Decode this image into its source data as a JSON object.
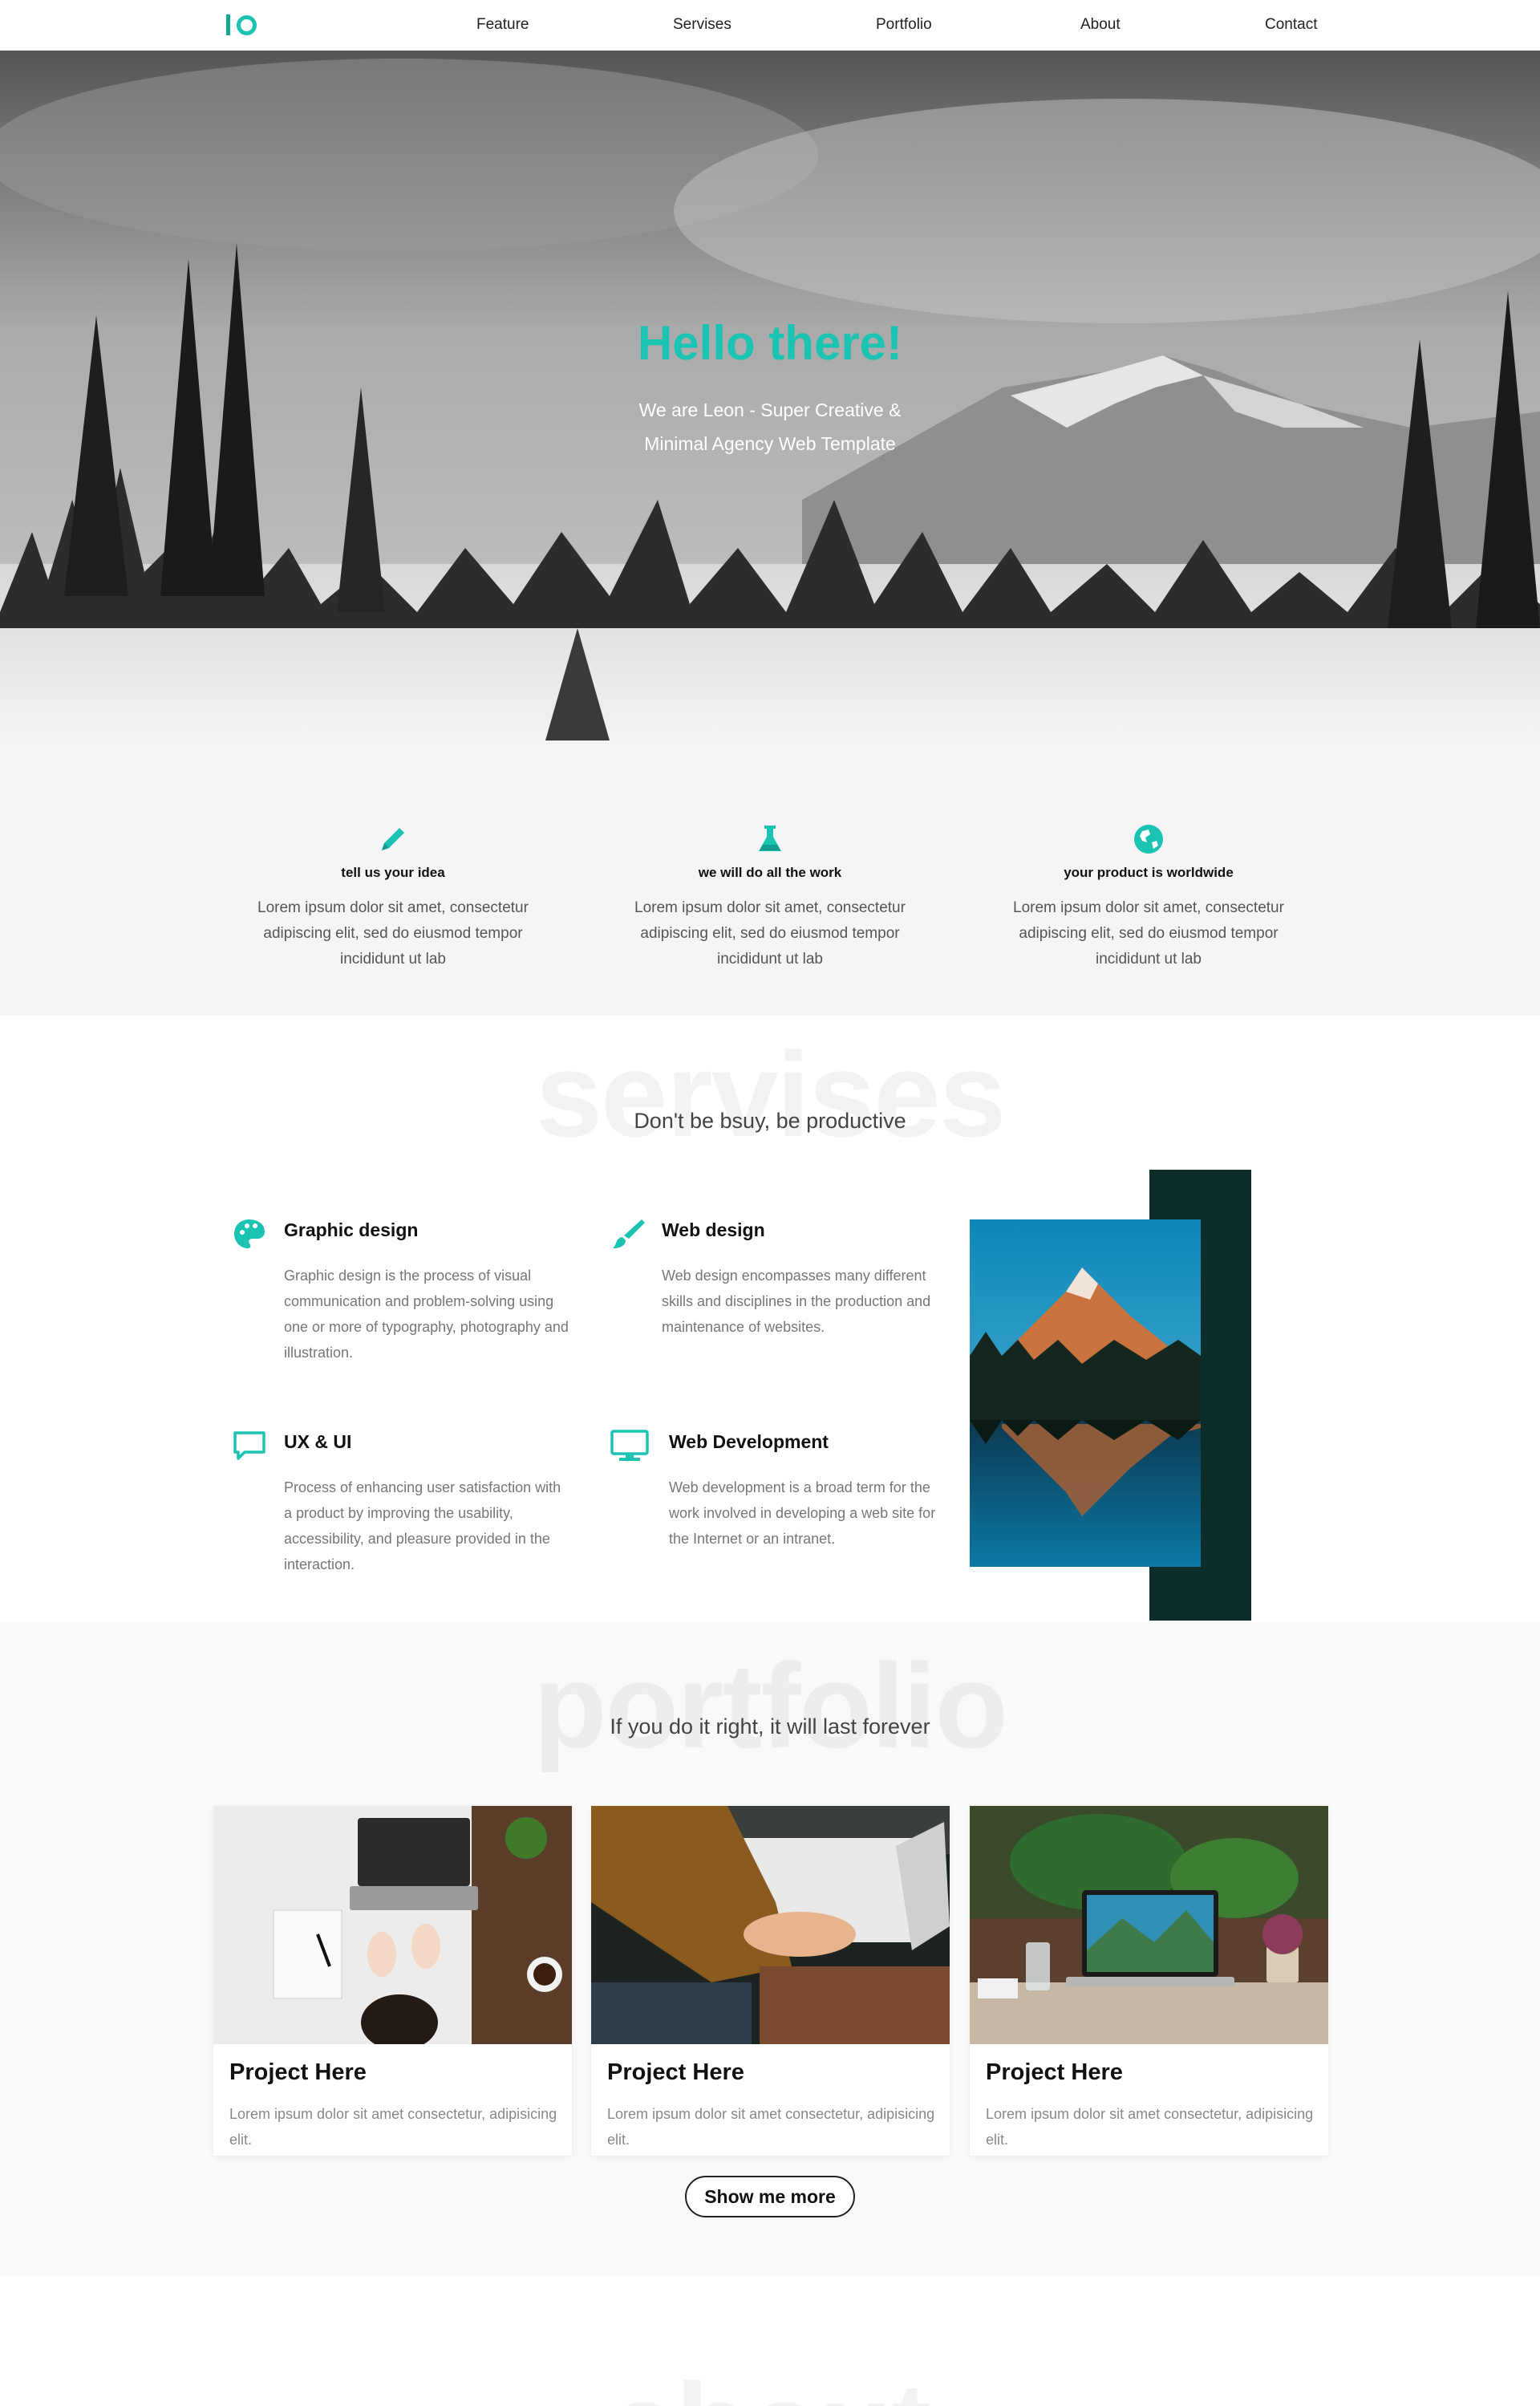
{
  "nav": {
    "items": [
      "Feature",
      "Servises",
      "Portfolio",
      "About",
      "Contact"
    ]
  },
  "hero": {
    "title": "Hello there!",
    "subtitle": "We are Leon - Super Creative & Minimal Agency Web Template"
  },
  "features": [
    {
      "icon": "pencil-icon",
      "title": "tell us your idea",
      "text": "Lorem ipsum dolor sit amet, consectetur adipiscing elit, sed do eiusmod tempor incididunt ut lab"
    },
    {
      "icon": "flask-icon",
      "title": "we will do all the work",
      "text": "Lorem ipsum dolor sit amet, consectetur adipiscing elit, sed do eiusmod tempor incididunt ut lab"
    },
    {
      "icon": "globe-icon",
      "title": "your product is worldwide",
      "text": "Lorem ipsum dolor sit amet, consectetur adipiscing elit, sed do eiusmod tempor incididunt ut lab"
    }
  ],
  "services": {
    "ghost": "servises",
    "subtitle": "Don't be bsuy, be productive",
    "items": [
      {
        "icon": "palette-icon",
        "title": "Graphic design",
        "text": "Graphic design is the process of visual communication and problem-solving using one or more of typography, photography and illustration."
      },
      {
        "icon": "brush-icon",
        "title": "Web design",
        "text": "Web design encompasses many different skills and disciplines in the production and maintenance of websites."
      },
      {
        "icon": "chat-icon",
        "title": "UX & UI",
        "text": "Process of enhancing user satisfaction with a product by improving the usability, accessibility, and pleasure provided in the interaction."
      },
      {
        "icon": "monitor-icon",
        "title": "Web Development",
        "text": "Web development is a broad term for the work involved in developing a web site for the Internet or an intranet."
      }
    ]
  },
  "portfolio": {
    "ghost": "portfolio",
    "subtitle": "If you do it right, it will last forever",
    "cards": [
      {
        "title": "Project Here",
        "text": "Lorem ipsum dolor sit amet consectetur, adipisicing elit."
      },
      {
        "title": "Project Here",
        "text": "Lorem ipsum dolor sit amet consectetur, adipisicing elit."
      },
      {
        "title": "Project Here",
        "text": "Lorem ipsum dolor sit amet consectetur, adipisicing elit."
      }
    ],
    "button": "Show me more"
  },
  "about": {
    "ghost": "about"
  },
  "colors": {
    "accent": "#1bc3b2",
    "dark_teal": "#0c2d2a"
  }
}
